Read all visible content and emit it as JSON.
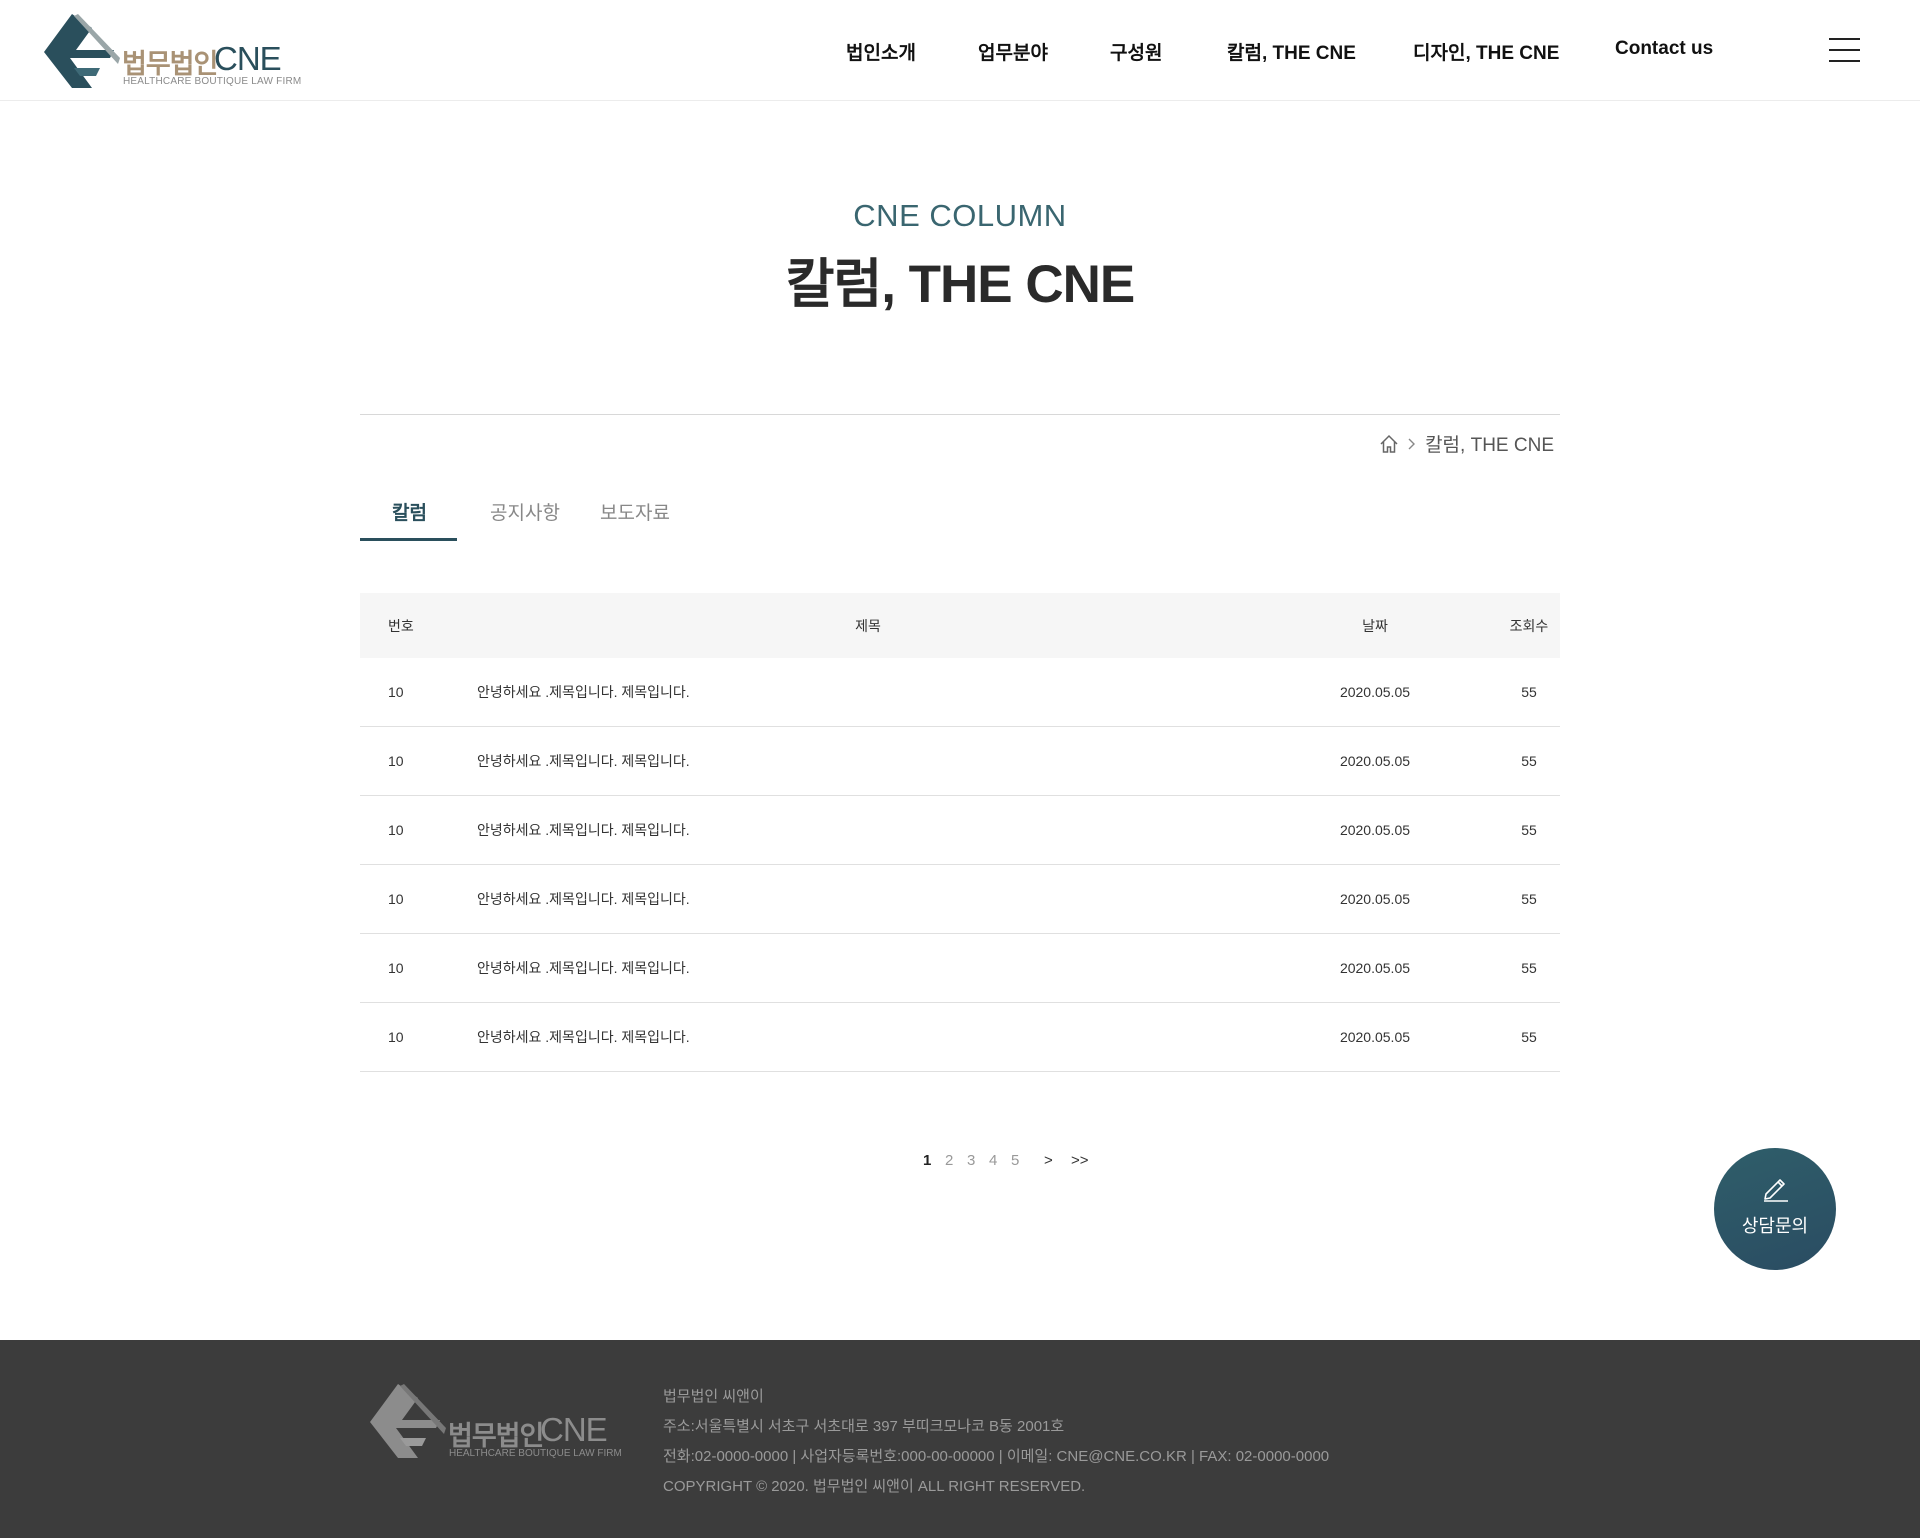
{
  "header": {
    "logo": {
      "name_ko": "법무법인",
      "name_en": "CNE",
      "tagline": "HEALTHCARE BOUTIQUE LAW FIRM"
    },
    "nav": [
      "법인소개",
      "업무분야",
      "구성원",
      "칼럼, THE CNE",
      "디자인, THE CNE",
      "Contact us"
    ],
    "menu_icon": "hamburger-icon"
  },
  "page": {
    "title_en": "CNE COLUMN",
    "title_ko": "칼럼, THE CNE",
    "breadcrumb": {
      "home_icon": "home-icon",
      "separator_icon": "chevron-right-icon",
      "current": "칼럼, THE CNE"
    }
  },
  "tabs": [
    {
      "label": "칼럼",
      "active": true
    },
    {
      "label": "공지사항",
      "active": false
    },
    {
      "label": "보도자료",
      "active": false
    }
  ],
  "table": {
    "headers": {
      "num": "번호",
      "title": "제목",
      "date": "날짜",
      "views": "조회수"
    },
    "rows": [
      {
        "num": "10",
        "title": "안녕하세요 .제목입니다. 제목입니다.",
        "date": "2020.05.05",
        "views": "55"
      },
      {
        "num": "10",
        "title": "안녕하세요 .제목입니다. 제목입니다.",
        "date": "2020.05.05",
        "views": "55"
      },
      {
        "num": "10",
        "title": "안녕하세요 .제목입니다. 제목입니다.",
        "date": "2020.05.05",
        "views": "55"
      },
      {
        "num": "10",
        "title": "안녕하세요 .제목입니다. 제목입니다.",
        "date": "2020.05.05",
        "views": "55"
      },
      {
        "num": "10",
        "title": "안녕하세요 .제목입니다. 제목입니다.",
        "date": "2020.05.05",
        "views": "55"
      },
      {
        "num": "10",
        "title": "안녕하세요 .제목입니다. 제목입니다.",
        "date": "2020.05.05",
        "views": "55"
      }
    ]
  },
  "pagination": {
    "pages": [
      "1",
      "2",
      "3",
      "4",
      "5"
    ],
    "current": "1",
    "next": ">",
    "last": ">>"
  },
  "consult_button": {
    "label": "상담문의",
    "icon": "pencil-icon"
  },
  "footer": {
    "logo": {
      "name_ko": "법무법인",
      "name_en": "CNE",
      "tagline": "HEALTHCARE BOUTIQUE LAW FIRM"
    },
    "company": "법무법인 씨앤이",
    "address": "주소:서울특별시 서초구 서초대로 397 부띠크모나코 B동 2001호",
    "contact": "전화:02-0000-0000 | 사업자등록번호:000-00-00000 | 이메일: CNE@CNE.CO.KR | FAX: 02-0000-0000",
    "copyright": "COPYRIGHT © 2020. 법무법인 씨앤이  ALL RIGHT RESERVED."
  },
  "colors": {
    "accent": "#2a4f5c",
    "logo_gold": "#a99275",
    "footer_bg": "#3c3c3c",
    "table_head_bg": "#f6f6f6"
  }
}
